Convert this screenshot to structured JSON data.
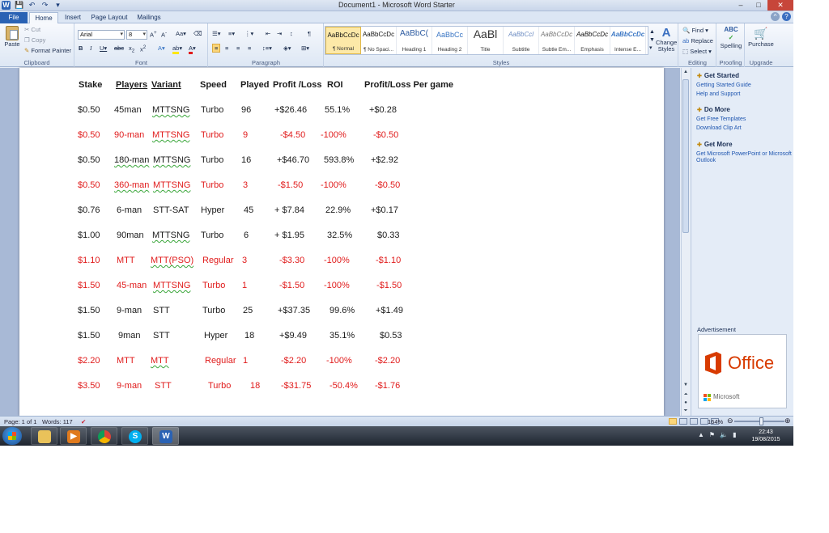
{
  "window": {
    "title": "Document1  -  Microsoft Word Starter",
    "quick_access": [
      "W",
      "💾",
      "↶",
      "↷",
      "▾"
    ],
    "controls": [
      "–",
      "□",
      "✕"
    ]
  },
  "tabs": [
    "File",
    "Home",
    "Insert",
    "Page Layout",
    "Mailings"
  ],
  "ribbon": {
    "clipboard": {
      "label": "Clipboard",
      "paste": "Paste",
      "cut": "Cut",
      "copy": "Copy",
      "format_painter": "Format Painter"
    },
    "font": {
      "label": "Font",
      "family": "Arial",
      "size": "8"
    },
    "paragraph": {
      "label": "Paragraph"
    },
    "styles": {
      "label": "Styles",
      "tiles": [
        {
          "sample": "AaBbCcDc",
          "name": "¶ Normal"
        },
        {
          "sample": "AaBbCcDc",
          "name": "¶ No Spaci..."
        },
        {
          "sample": "AaBbC(",
          "name": "Heading 1"
        },
        {
          "sample": "AaBbCc",
          "name": "Heading 2"
        },
        {
          "sample": "AaBl",
          "name": "Title"
        },
        {
          "sample": "AaBbCcl",
          "name": "Subtitle"
        },
        {
          "sample": "AaBbCcDc",
          "name": "Subtle Em..."
        },
        {
          "sample": "AaBbCcDc",
          "name": "Emphasis"
        },
        {
          "sample": "AaBbCcDc",
          "name": "Intense E..."
        }
      ],
      "change_styles": "Change Styles"
    },
    "editing": {
      "label": "Editing",
      "find": "Find",
      "replace": "Replace",
      "select": "Select"
    },
    "proofing": {
      "label": "Proofing",
      "spelling": "Spelling"
    },
    "upgrade": {
      "label": "Upgrade",
      "purchase": "Purchase"
    }
  },
  "document": {
    "headers": [
      "Stake",
      "Players",
      "Variant",
      "Speed",
      "Played",
      "Profit /Loss",
      "ROI",
      "Profit/Loss Per game"
    ],
    "rows": [
      {
        "red": false,
        "cells": [
          "$0.50",
          "45man",
          "MTTSNG",
          "Turbo",
          "96",
          "+$26.46",
          "55.1%",
          "+$0.28"
        ]
      },
      {
        "red": true,
        "cells": [
          "$0.50",
          "90-man",
          "MTTSNG",
          "Turbo",
          "9",
          "-$4.50",
          "-100%",
          "-$0.50"
        ]
      },
      {
        "red": false,
        "cells": [
          "$0.50",
          "180-man",
          "MTTSNG",
          "Turbo",
          "16",
          "+$46.70",
          "593.8%",
          "+$2.92"
        ]
      },
      {
        "red": true,
        "cells": [
          "$0.50",
          "360-man",
          "MTTSNG",
          "Turbo",
          "3",
          "-$1.50",
          "-100%",
          "-$0.50"
        ]
      },
      {
        "red": false,
        "cells": [
          "$0.76",
          "6-man",
          "STT-SAT",
          "Hyper",
          "45",
          "+ $7.84",
          "22.9%",
          "+$0.17"
        ]
      },
      {
        "red": false,
        "cells": [
          "$1.00",
          "90man",
          "MTTSNG",
          "Turbo",
          "6",
          "+ $1.95",
          "32.5%",
          "$0.33"
        ]
      },
      {
        "red": true,
        "cells": [
          "$1.10",
          "MTT",
          "MTT(PSO)",
          "Regular",
          "3",
          "-$3.30",
          "-100%",
          "-$1.10"
        ]
      },
      {
        "red": true,
        "cells": [
          "$1.50",
          "45-man",
          "MTTSNG",
          "Turbo",
          "1",
          "-$1.50",
          "-100%",
          "-$1.50"
        ]
      },
      {
        "red": false,
        "cells": [
          "$1.50",
          "9-man",
          "STT",
          "Turbo",
          "25",
          "+$37.35",
          "99.6%",
          "+$1.49"
        ]
      },
      {
        "red": false,
        "cells": [
          "$1.50",
          "9man",
          "STT",
          "Hyper",
          "18",
          "+$9.49",
          "35.1%",
          "$0.53"
        ]
      },
      {
        "red": true,
        "cells": [
          "$2.20",
          "MTT",
          "MTT",
          "Regular",
          "1",
          "-$2.20",
          "-100%",
          "-$2.20"
        ]
      },
      {
        "red": true,
        "cells": [
          "$3.50",
          "9-man",
          "STT",
          "Turbo",
          "18",
          "-$31.75",
          "-50.4%",
          "-$1.76"
        ]
      }
    ]
  },
  "task_pane": {
    "sections": [
      {
        "heading": "Get Started",
        "links": [
          "Getting Started Guide",
          "Help and Support"
        ]
      },
      {
        "heading": "Do More",
        "links": [
          "Get Free Templates",
          "Download Clip Art"
        ]
      },
      {
        "heading": "Get More",
        "links": [
          "Get Microsoft PowerPoint or Microsoft Outlook"
        ]
      }
    ],
    "ad_label": "Advertisement",
    "ad_product": "Office",
    "ad_brand": "Microsoft"
  },
  "status_bar": {
    "page": "Page: 1 of 1",
    "words": "Words: 117",
    "zoom": "164%"
  },
  "taskbar": {
    "time": "22:43",
    "date": "19/08/2015"
  },
  "colors": {
    "loss_red": "#e01b1b",
    "word_blue": "#2a62b4",
    "office_orange": "#d83b01"
  }
}
